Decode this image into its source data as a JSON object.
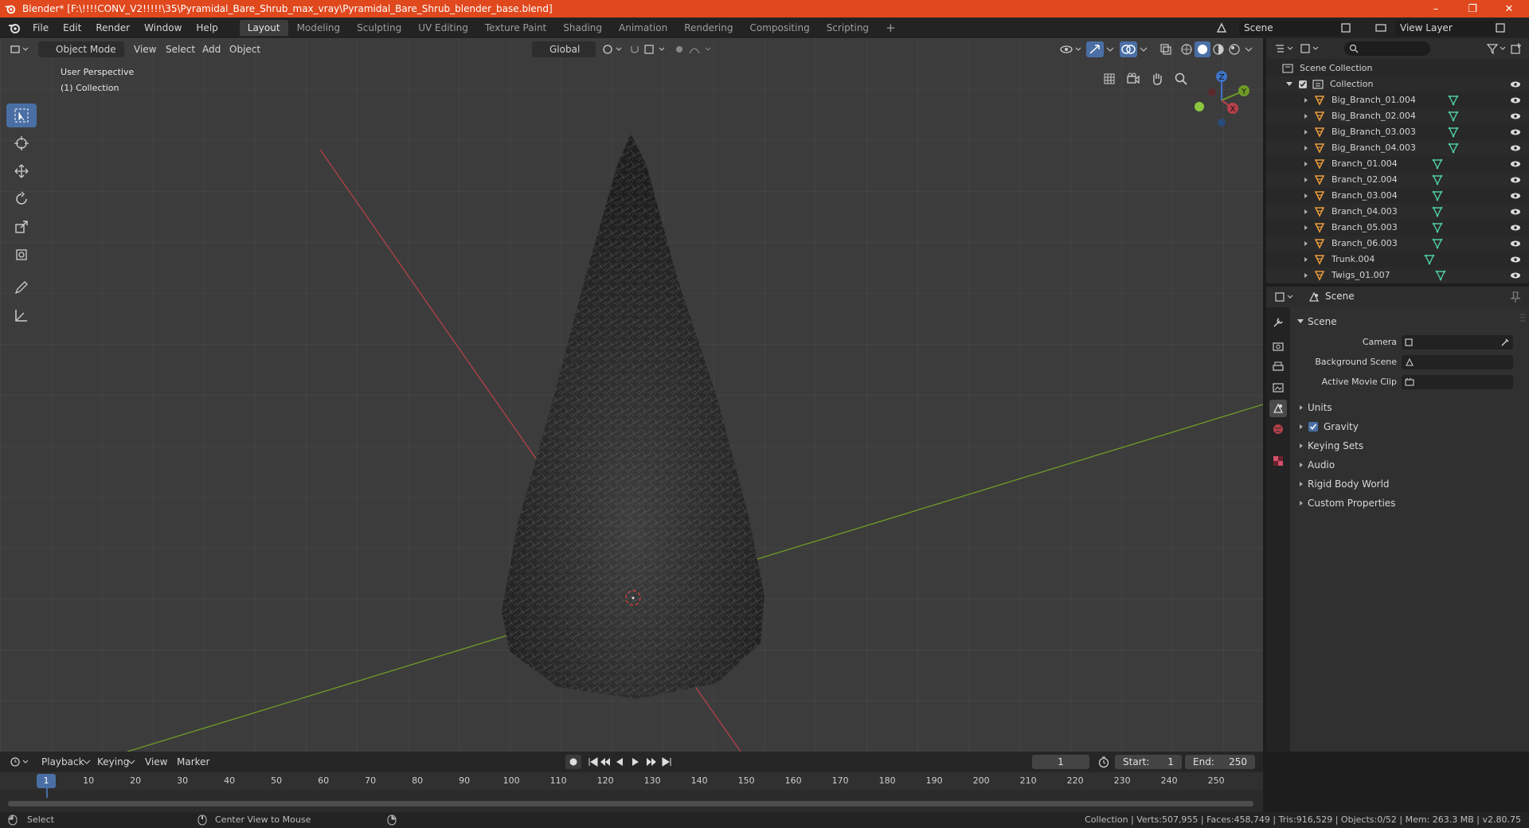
{
  "window": {
    "title": "Blender* [F:\\!!!!CONV_V2!!!!!\\35\\Pyramidal_Bare_Shrub_max_vray\\Pyramidal_Bare_Shrub_blender_base.blend]",
    "minimize": "–",
    "maximize": "❐",
    "close": "✕"
  },
  "menu": {
    "items": [
      "File",
      "Edit",
      "Render",
      "Window",
      "Help"
    ],
    "workspaces": [
      "Layout",
      "Modeling",
      "Sculpting",
      "UV Editing",
      "Texture Paint",
      "Shading",
      "Animation",
      "Rendering",
      "Compositing",
      "Scripting"
    ],
    "active_workspace": "Layout",
    "add_workspace": "+",
    "scene_label": "Scene",
    "view_layer_label": "View Layer"
  },
  "viewport": {
    "mode": "Object Mode",
    "menus": [
      "View",
      "Select",
      "Add",
      "Object"
    ],
    "transform_orientation": "Global",
    "perspective_label": "User Perspective",
    "collection_label": "(1) Collection",
    "gizmo": {
      "x": "X",
      "y": "Y",
      "z": "Z"
    },
    "colors": {
      "x_axis": "#b5404a",
      "y_axis": "#6e9b28",
      "z_axis": "#3d73c8",
      "accent": "#4a6fa5"
    }
  },
  "outliner": {
    "search_placeholder": "",
    "root": "Scene Collection",
    "collection": "Collection",
    "objects": [
      "Big_Branch_01.004",
      "Big_Branch_02.004",
      "Big_Branch_03.003",
      "Big_Branch_04.003",
      "Branch_01.004",
      "Branch_02.004",
      "Branch_03.004",
      "Branch_04.003",
      "Branch_05.003",
      "Branch_06.003",
      "Trunk.004",
      "Twigs_01.007"
    ]
  },
  "properties": {
    "context": "Scene",
    "panel_title": "Scene",
    "fields": {
      "camera_label": "Camera",
      "background_scene_label": "Background Scene",
      "active_movie_clip_label": "Active Movie Clip"
    },
    "subpanels": [
      "Units",
      "Gravity",
      "Keying Sets",
      "Audio",
      "Rigid Body World",
      "Custom Properties"
    ],
    "gravity_checked": true
  },
  "timeline": {
    "menus": [
      "Playback",
      "Keying",
      "View",
      "Marker"
    ],
    "current_frame": "1",
    "start_label": "Start:",
    "start": "1",
    "end_label": "End:",
    "end": "250",
    "ruler_ticks": [
      "1",
      "10",
      "20",
      "30",
      "40",
      "50",
      "60",
      "70",
      "80",
      "90",
      "100",
      "110",
      "120",
      "130",
      "140",
      "150",
      "160",
      "170",
      "180",
      "190",
      "200",
      "210",
      "220",
      "230",
      "240",
      "250"
    ]
  },
  "status": {
    "left_action": "Select",
    "middle_action": "Center View to Mouse",
    "stats": "Collection | Verts:507,955 | Faces:458,749 | Tris:916,529 | Objects:0/52 | Mem: 263.3 MB | v2.80.75"
  }
}
